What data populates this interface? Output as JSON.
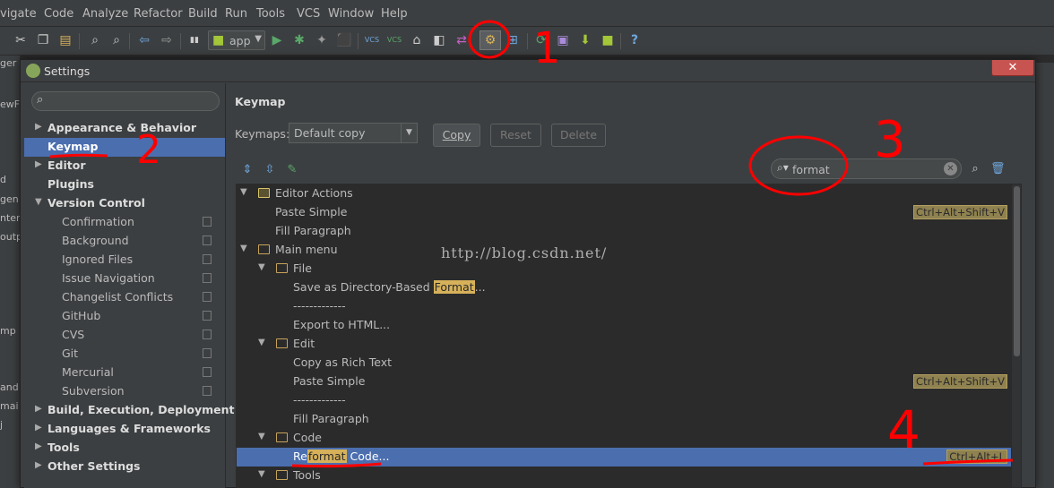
{
  "menubar": {
    "items": [
      "vigate",
      "Code",
      "Analyze",
      "Refactor",
      "Build",
      "Run",
      "Tools",
      "VCS",
      "Window",
      "Help"
    ]
  },
  "toolbar": {
    "run_config": "app",
    "icons": [
      "cut-icon",
      "copy-icon",
      "paste-icon",
      "find-icon",
      "replace-icon",
      "back-icon",
      "forward-icon",
      "make-icon",
      "android-icon",
      "run-icon",
      "debug-icon",
      "coverage-icon",
      "stop-icon",
      "vcs-update-icon",
      "vcs-commit-icon",
      "history-icon",
      "compare-icon",
      "revert-icon",
      "settings-icon",
      "structure-icon",
      "sync-icon",
      "avd-manager-icon",
      "sdk-manager-icon",
      "android-monitor-icon",
      "help-icon"
    ]
  },
  "left_strip": [
    "ger",
    "ewF",
    "d",
    "gen",
    "nter",
    "outp",
    "mp",
    "and",
    "mai",
    "j"
  ],
  "dialog": {
    "title": "Settings",
    "close_label": "✕"
  },
  "nav": {
    "items": [
      {
        "label": "Appearance & Behavior",
        "bold": true,
        "expandable": true,
        "expanded": false
      },
      {
        "label": "Keymap",
        "bold": true,
        "selected": true
      },
      {
        "label": "Editor",
        "bold": true,
        "expandable": true,
        "expanded": false
      },
      {
        "label": "Plugins",
        "bold": true
      },
      {
        "label": "Version Control",
        "bold": true,
        "expandable": true,
        "expanded": true
      },
      {
        "label": "Confirmation"
      },
      {
        "label": "Background"
      },
      {
        "label": "Ignored Files"
      },
      {
        "label": "Issue Navigation"
      },
      {
        "label": "Changelist Conflicts"
      },
      {
        "label": "GitHub"
      },
      {
        "label": "CVS"
      },
      {
        "label": "Git"
      },
      {
        "label": "Mercurial"
      },
      {
        "label": "Subversion"
      },
      {
        "label": "Build, Execution, Deployment",
        "bold": true,
        "expandable": true,
        "expanded": false
      },
      {
        "label": "Languages & Frameworks",
        "bold": true,
        "expandable": true,
        "expanded": false
      },
      {
        "label": "Tools",
        "bold": true,
        "expandable": true,
        "expanded": false
      },
      {
        "label": "Other Settings",
        "bold": true,
        "expandable": true,
        "expanded": false
      }
    ]
  },
  "keymap": {
    "title": "Keymap",
    "keymaps_label": "Keymaps:",
    "selected_keymap": "Default copy",
    "copy_label": "Copy",
    "reset_label": "Reset",
    "delete_label": "Delete",
    "filter_value": "format"
  },
  "tree": {
    "rows": [
      {
        "label": "Editor Actions",
        "level": 0,
        "folder": true,
        "expanded": true,
        "icon": "editor-actions-icon"
      },
      {
        "label": "Paste Simple",
        "level": 1,
        "shortcut": "Ctrl+Alt+Shift+V"
      },
      {
        "label": "Fill Paragraph",
        "level": 1
      },
      {
        "label": "Main menu",
        "level": 0,
        "folder": true,
        "expanded": true
      },
      {
        "label": "File",
        "level": 1,
        "folder": true,
        "expanded": true
      },
      {
        "pre": "Save as Directory-Based ",
        "match": "Format",
        "post": "...",
        "level": 2
      },
      {
        "label": "-------------",
        "level": 2
      },
      {
        "label": "Export to HTML...",
        "level": 2
      },
      {
        "label": "Edit",
        "level": 1,
        "folder": true,
        "expanded": true
      },
      {
        "label": "Copy as Rich Text",
        "level": 2
      },
      {
        "label": "Paste Simple",
        "level": 2,
        "shortcut": "Ctrl+Alt+Shift+V"
      },
      {
        "label": "-------------",
        "level": 2
      },
      {
        "label": "Fill Paragraph",
        "level": 2
      },
      {
        "label": "Code",
        "level": 1,
        "folder": true,
        "expanded": true
      },
      {
        "pre": "Re",
        "match": "format",
        "post": " Code...",
        "level": 2,
        "selected": true,
        "shortcut": "Ctrl+Alt+L"
      },
      {
        "label": "Tools",
        "level": 1,
        "folder": true,
        "expanded": true
      }
    ]
  },
  "watermark": "http://blog.csdn.net/",
  "annotations": [
    "1",
    "2",
    "3",
    "4"
  ],
  "colors": {
    "background": "#3c3f41",
    "selection": "#4b6eaf",
    "annotation_red": "#ff0000",
    "search_highlight": "#d6b15a",
    "shortcut_bg": "#8f8250"
  }
}
